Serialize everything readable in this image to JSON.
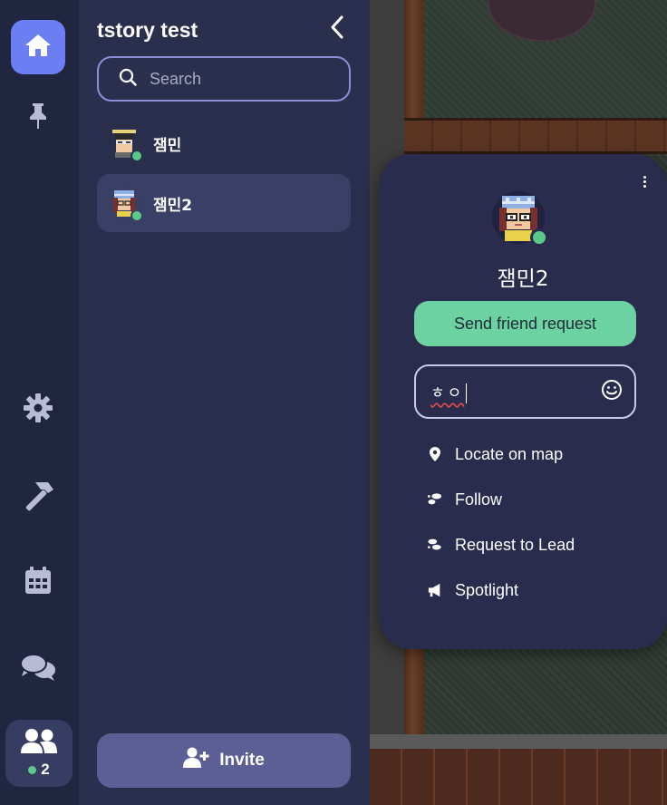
{
  "rail": {
    "items": [
      {
        "name": "home",
        "icon": "home-icon",
        "active": true
      },
      {
        "name": "pin",
        "icon": "pin-icon"
      },
      {
        "name": "settings",
        "icon": "gear-icon"
      },
      {
        "name": "build",
        "icon": "hammer-icon"
      },
      {
        "name": "calendar",
        "icon": "calendar-icon"
      },
      {
        "name": "chat",
        "icon": "chat-bubbles-icon"
      },
      {
        "name": "people",
        "icon": "people-icon",
        "active": true
      }
    ],
    "online_count": "2"
  },
  "panel": {
    "title": "tstory test",
    "search_placeholder": "Search",
    "users": [
      {
        "name": "잼민",
        "status": "online"
      },
      {
        "name": "잼민2",
        "status": "online",
        "selected": true
      }
    ],
    "invite_label": "Invite"
  },
  "profile_card": {
    "name": "잼민2",
    "friend_button": "Send friend request",
    "message_value": "ㅎㅇ",
    "actions": [
      {
        "label": "Locate on map",
        "icon": "map-pin-icon"
      },
      {
        "label": "Follow",
        "icon": "footsteps-icon"
      },
      {
        "label": "Request to Lead",
        "icon": "footsteps-lead-icon"
      },
      {
        "label": "Spotlight",
        "icon": "megaphone-icon"
      }
    ]
  },
  "colors": {
    "accent": "#6c7ff2",
    "online": "#5ac989",
    "friend_button": "#6dd2a2",
    "panel_bg": "#2b2f4e",
    "rail_bg": "#202540"
  }
}
